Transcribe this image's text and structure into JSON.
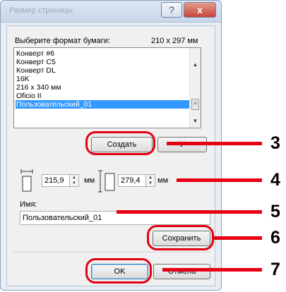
{
  "dialog": {
    "title": "Размер страницы",
    "help_glyph": "?",
    "close_glyph": "x"
  },
  "format": {
    "label": "Выберите формат бумаги:",
    "size_readout": "210 x 297 мм",
    "items": [
      "Конверт #6",
      "Конверт C5",
      "Конверт DL",
      "16K",
      "216 x 340 мм",
      "Oficio II",
      "Пользовательский_01"
    ],
    "selected": "Пользовательский_01"
  },
  "buttons": {
    "create": "Создать",
    "delete": "У",
    "save": "Сохранить",
    "ok": "OK",
    "cancel": "Отмена"
  },
  "dimensions": {
    "width": "215,9",
    "height": "279,4",
    "unit": "мм"
  },
  "name": {
    "label": "Имя:",
    "value": "Пользовательский_01"
  },
  "callouts": [
    "3",
    "4",
    "5",
    "6",
    "7"
  ],
  "colors": {
    "callout": "#e60012",
    "selection": "#3399ff"
  }
}
